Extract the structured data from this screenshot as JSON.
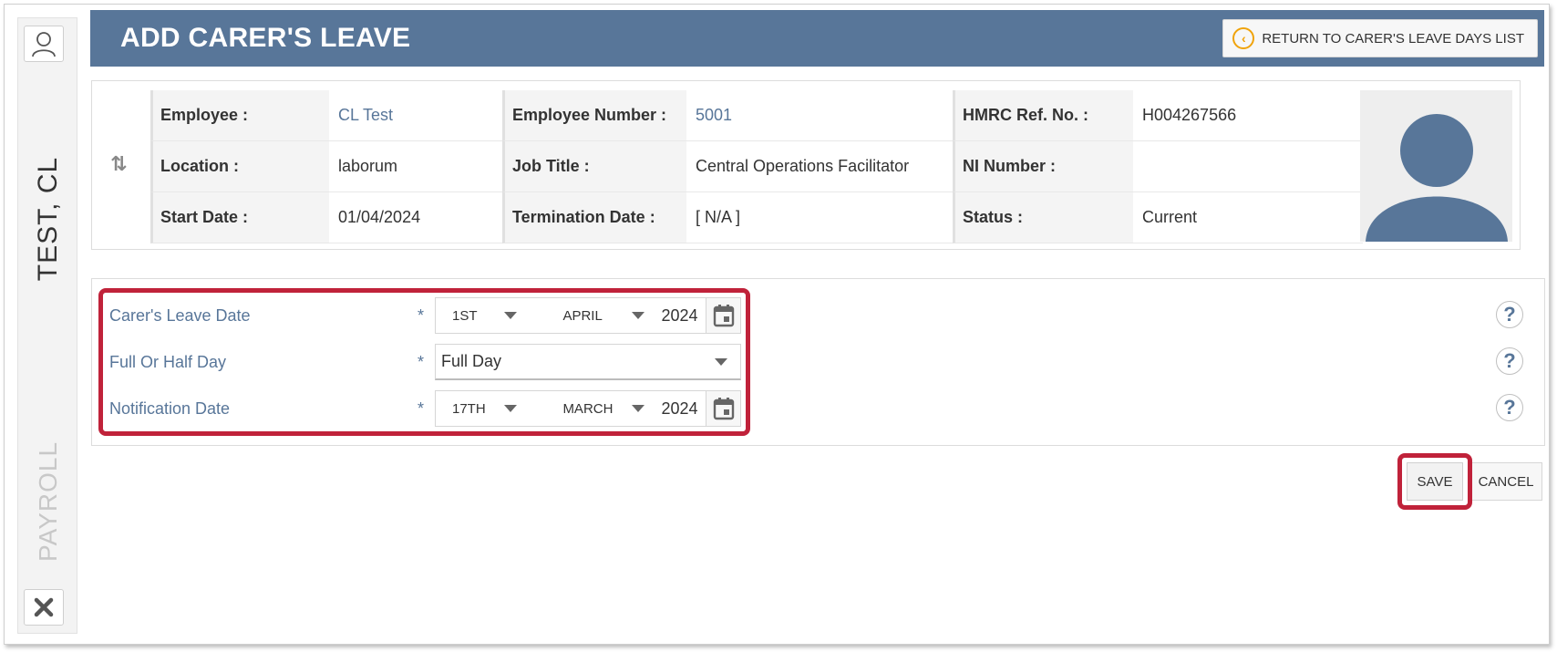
{
  "sidebar": {
    "employee_name": "TEST, CL",
    "module": "PAYROLL",
    "user_icon": "user-icon",
    "close_icon": "close-icon"
  },
  "header": {
    "title": "ADD CARER'S LEAVE",
    "return_label": "RETURN TO CARER'S LEAVE DAYS LIST",
    "return_icon": "chevron-left-circle-icon"
  },
  "employee": {
    "rows": [
      [
        {
          "label": "Employee :",
          "value": "CL Test",
          "link": true
        },
        {
          "label": "Employee Number :",
          "value": "5001",
          "link": true
        },
        {
          "label": "HMRC Ref. No. :",
          "value": "H004267566",
          "link": false
        }
      ],
      [
        {
          "label": "Location :",
          "value": "laborum",
          "link": false
        },
        {
          "label": "Job Title :",
          "value": "Central Operations Facilitator",
          "link": false
        },
        {
          "label": "NI Number :",
          "value": "",
          "link": false
        }
      ],
      [
        {
          "label": "Start Date :",
          "value": "01/04/2024",
          "link": false
        },
        {
          "label": "Termination Date :",
          "value": "[ N/A ]",
          "link": false
        },
        {
          "label": "Status :",
          "value": "Current",
          "link": false
        }
      ]
    ]
  },
  "form": {
    "carers_leave_date": {
      "label": "Carer's Leave Date",
      "required": "*",
      "day": "1ST",
      "month": "APRIL",
      "year": "2024"
    },
    "full_or_half_day": {
      "label": "Full Or Half Day",
      "required": "*",
      "value": "Full Day"
    },
    "notification_date": {
      "label": "Notification Date",
      "required": "*",
      "day": "17TH",
      "month": "MARCH",
      "year": "2024"
    },
    "help_glyph": "?"
  },
  "actions": {
    "save_label": "SAVE",
    "cancel_label": "CANCEL"
  },
  "colors": {
    "header_bg": "#587699",
    "accent_orange": "#f0a30a",
    "highlight_red": "#c0223a",
    "label_blue": "#587699"
  }
}
